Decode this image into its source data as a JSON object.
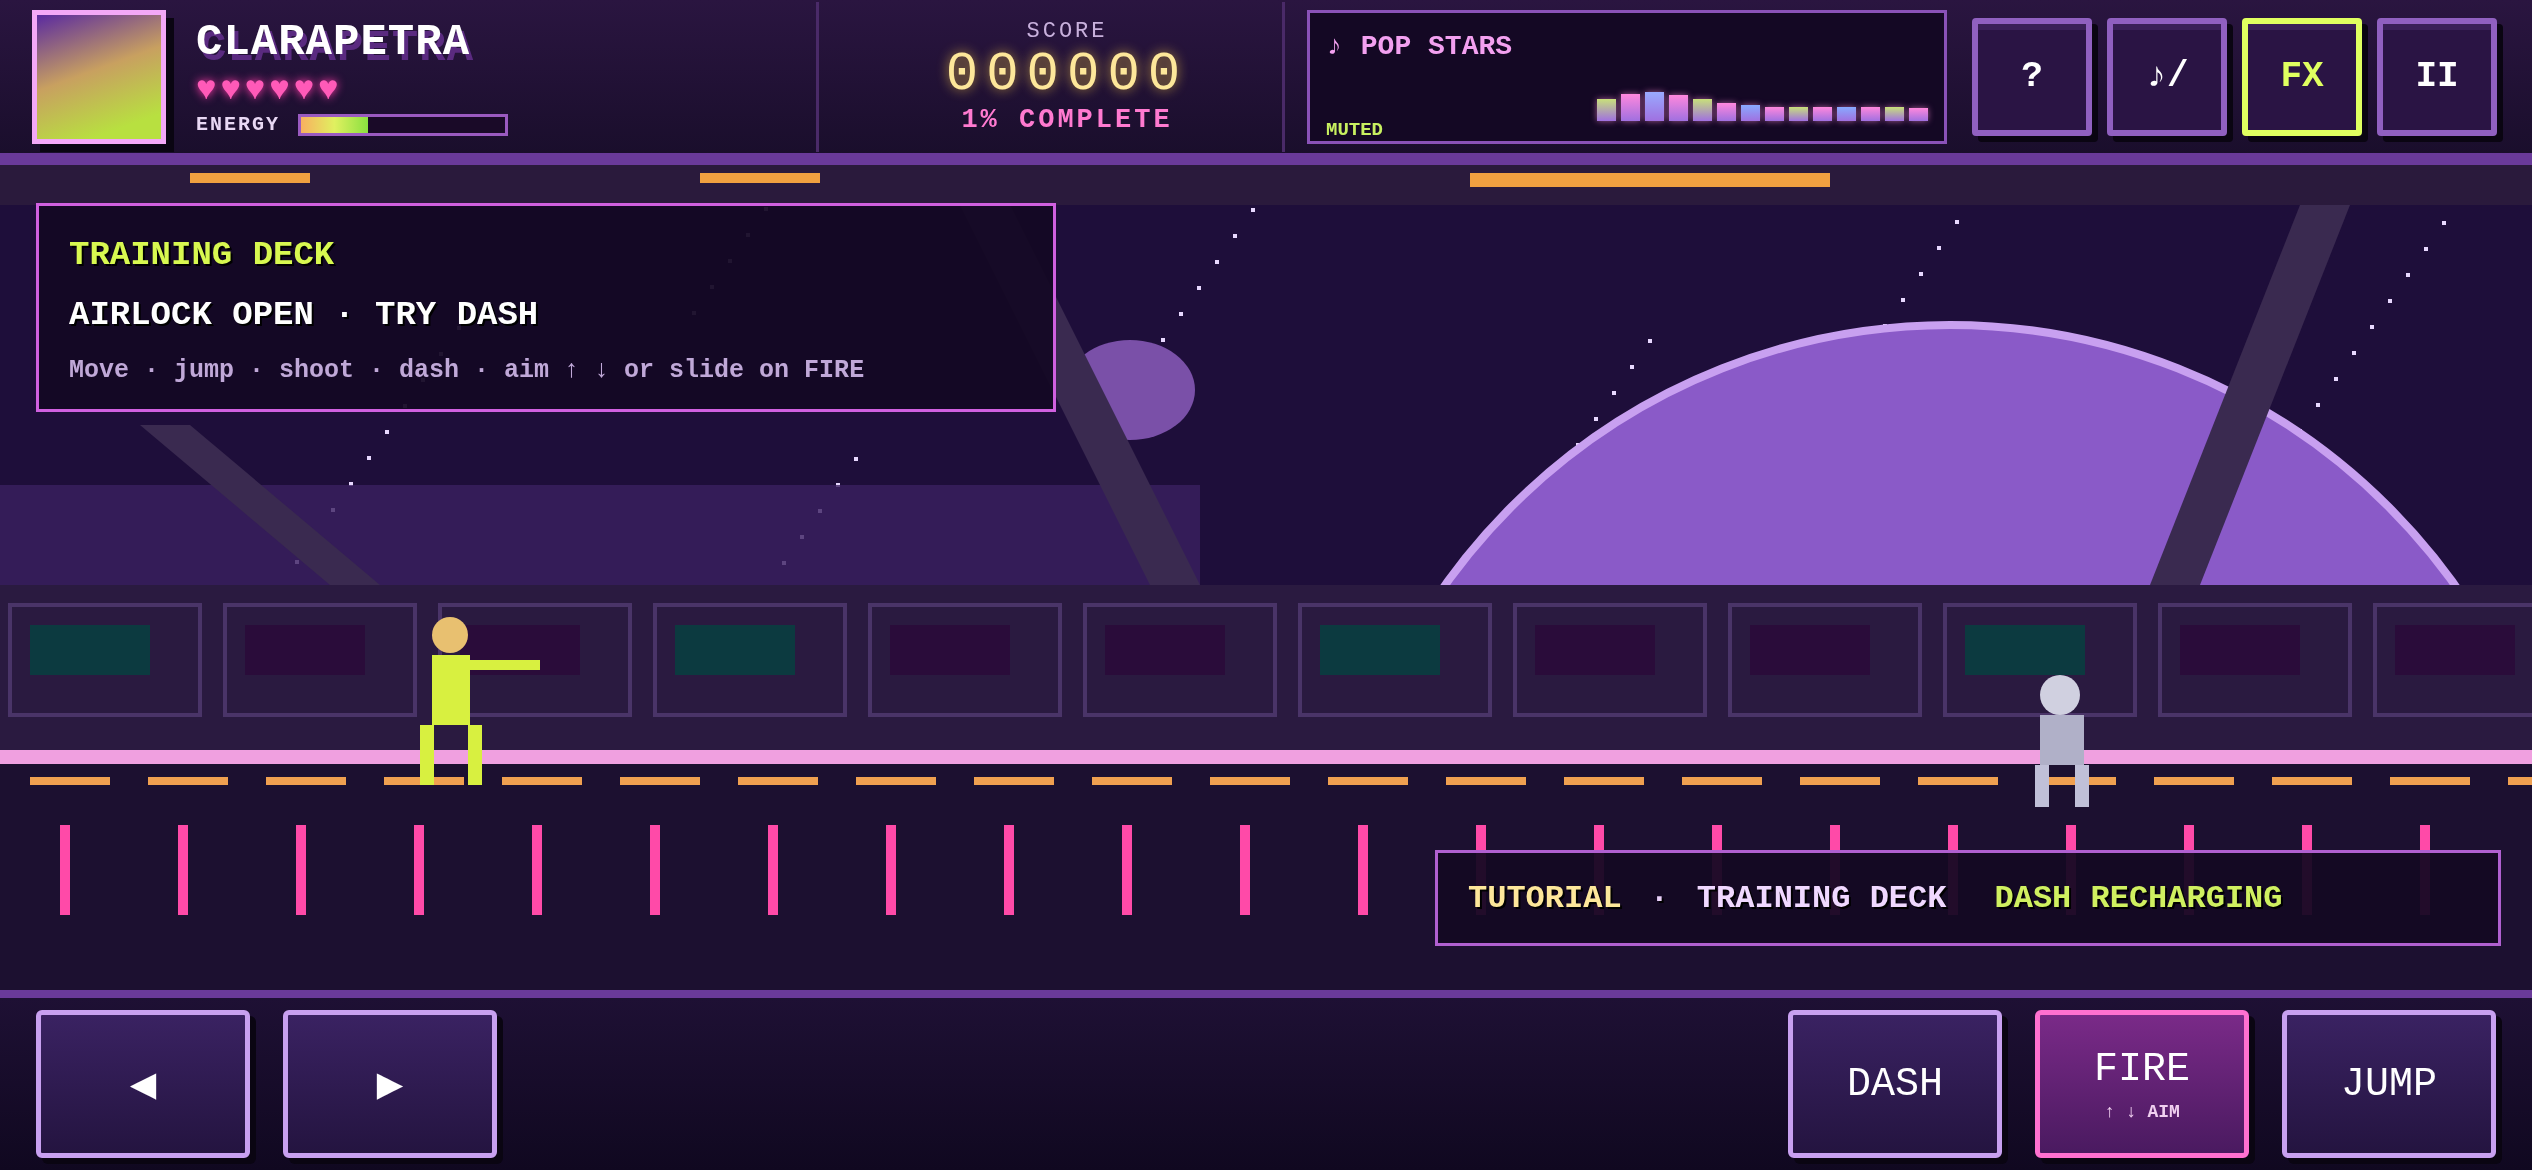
{
  "player": {
    "name": "CLARAPETRA",
    "hearts": [
      "♥",
      "♥",
      "♥",
      "♥",
      "♥",
      "♥"
    ],
    "energy": {
      "label": "ENERGY",
      "level": 0.33
    }
  },
  "score": {
    "label": "SCORE",
    "value": "000000",
    "progress": "1% COMPLETE"
  },
  "music": {
    "note": "♪",
    "title": "POP STARS",
    "status": "MUTED"
  },
  "toolbar": [
    {
      "label": "?",
      "on": false
    },
    {
      "label": "♪/",
      "on": false
    },
    {
      "label": "FX",
      "on": true
    },
    {
      "label": "II",
      "on": false
    }
  ],
  "briefing": {
    "area": "TRAINING DECK",
    "objective": "AIRLOCK OPEN · TRY DASH",
    "hint": "Move · jump · shoot · dash · aim ↑ ↓ or slide on FIRE"
  },
  "status_bar": [
    {
      "kind": "mode",
      "text": "TUTORIAL"
    },
    {
      "kind": "separator",
      "text": "·"
    },
    {
      "kind": "area",
      "text": "TRAINING DECK"
    },
    {
      "kind": "alert",
      "text": "DASH RECHARGING"
    }
  ],
  "controls_left": [
    {
      "label": "◀",
      "active": false
    },
    {
      "label": "▶",
      "active": false
    }
  ],
  "controls_right": [
    {
      "label": "DASH",
      "active": false
    },
    {
      "label": "FIRE",
      "sub": "↑ ↓ AIM",
      "active": true
    },
    {
      "label": "JUMP",
      "active": false
    }
  ]
}
